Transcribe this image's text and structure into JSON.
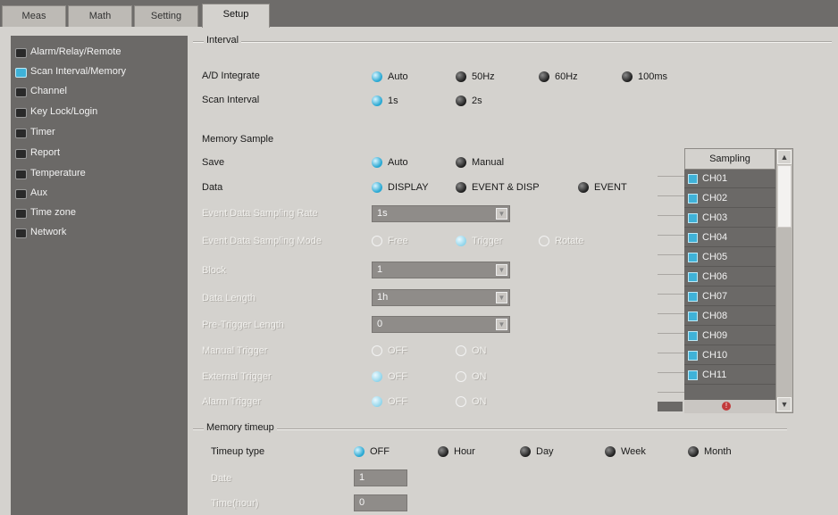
{
  "tabs": [
    "Meas",
    "Math",
    "Setting",
    "Setup"
  ],
  "sidebar": {
    "items": [
      {
        "label": "Alarm/Relay/Remote",
        "selected": false
      },
      {
        "label": "Scan Interval/Memory",
        "selected": true
      },
      {
        "label": "Channel",
        "selected": false
      },
      {
        "label": "Key Lock/Login",
        "selected": false
      },
      {
        "label": "Timer",
        "selected": false
      },
      {
        "label": "Report",
        "selected": false
      },
      {
        "label": "Temperature",
        "selected": false
      },
      {
        "label": "Aux",
        "selected": false
      },
      {
        "label": "Time zone",
        "selected": false
      },
      {
        "label": "Network",
        "selected": false
      }
    ]
  },
  "interval": {
    "title": "Interval",
    "ad_integrate": {
      "label": "A/D Integrate",
      "options": [
        "Auto",
        "50Hz",
        "60Hz",
        "100ms"
      ],
      "selected": "Auto"
    },
    "scan_interval": {
      "label": "Scan Interval",
      "options": [
        "1s",
        "2s"
      ],
      "selected": "1s"
    }
  },
  "memory_sample": {
    "title": "Memory Sample",
    "save": {
      "label": "Save",
      "options": [
        "Auto",
        "Manual"
      ],
      "selected": "Auto"
    },
    "data": {
      "label": "Data",
      "options": [
        "DISPLAY",
        "EVENT & DISP",
        "EVENT"
      ],
      "selected": "DISPLAY"
    },
    "event_rate": {
      "label": "Event Data Sampling Rate",
      "value": "1s"
    },
    "event_mode": {
      "label": "Event Data Sampling Mode",
      "options": [
        "Free",
        "Trigger",
        "Rotate"
      ],
      "selected": "Trigger"
    },
    "block": {
      "label": "Block",
      "value": "1"
    },
    "data_length": {
      "label": "Data Length",
      "value": "1h"
    },
    "pretrigger": {
      "label": "Pre-Trigger Length",
      "value": "0"
    },
    "manual_trigger": {
      "label": "Manual Trigger",
      "options": [
        "OFF",
        "ON"
      ],
      "selected": "OFF"
    },
    "external_trigger": {
      "label": "External Trigger",
      "options": [
        "OFF",
        "ON"
      ],
      "selected": "OFF"
    },
    "alarm_trigger": {
      "label": "Alarm Trigger",
      "options": [
        "OFF",
        "ON"
      ],
      "selected": "OFF"
    }
  },
  "sampling": {
    "header": "Sampling",
    "channels": [
      "CH01",
      "CH02",
      "CH03",
      "CH04",
      "CH05",
      "CH06",
      "CH07",
      "CH08",
      "CH09",
      "CH10",
      "CH11"
    ]
  },
  "memory_timeup": {
    "title": "Memory timeup",
    "timeup_type": {
      "label": "Timeup type",
      "options": [
        "OFF",
        "Hour",
        "Day",
        "Week",
        "Month"
      ],
      "selected": "OFF"
    },
    "date": {
      "label": "Date",
      "value": "1"
    },
    "time_hour": {
      "label": "Time(hour)",
      "value": "0"
    }
  },
  "colors": {
    "accent": "#3fb2d8",
    "sidebar": "#6b6967",
    "panel": "#d4d2ce"
  }
}
